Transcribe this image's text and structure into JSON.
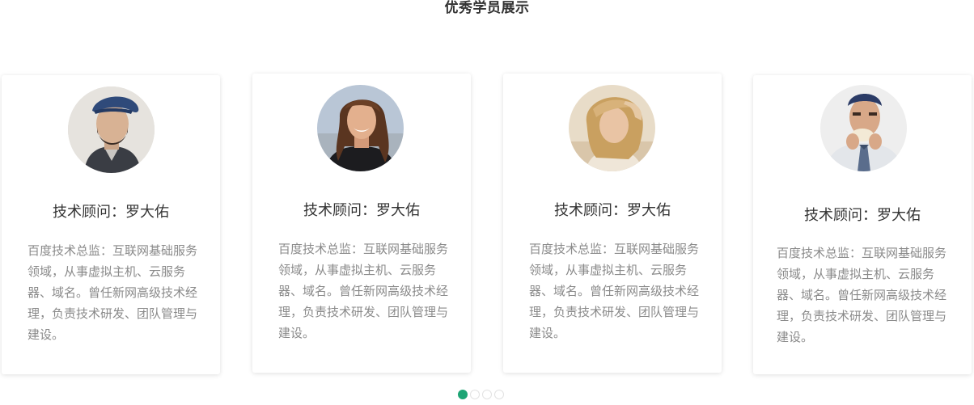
{
  "section": {
    "title": "优秀学员展示"
  },
  "cards": [
    {
      "name": "技术顾问：罗大佑",
      "description": "百度技术总监：互联网基础服务领域，从事虚拟主机、云服务器、域名。曾任新网高级技术经理，负责技术研发、团队管理与建设。",
      "avatar": "man-with-cap-avatar"
    },
    {
      "name": "技术顾问：罗大佑",
      "description": "百度技术总监：互联网基础服务领域，从事虚拟主机、云服务器、域名。曾任新网高级技术经理，负责技术研发、团队管理与建设。",
      "avatar": "smiling-woman-avatar"
    },
    {
      "name": "技术顾问：罗大佑",
      "description": "百度技术总监：互联网基础服务领域，从事虚拟主机、云服务器、域名。曾任新网高级技术经理，负责技术研发、团队管理与建设。",
      "avatar": "blonde-woman-avatar"
    },
    {
      "name": "技术顾问：罗大佑",
      "description": "百度技术总监：互联网基础服务领域，从事虚拟主机、云服务器、域名。曾任新网高级技术经理，负责技术研发、团队管理与建设。",
      "avatar": "man-with-tie-avatar"
    }
  ],
  "carousel": {
    "page_count": 4,
    "active_index": 0
  },
  "colors": {
    "accent": "#1ea575",
    "title_text": "#333333",
    "body_text": "#8a8a8a"
  }
}
